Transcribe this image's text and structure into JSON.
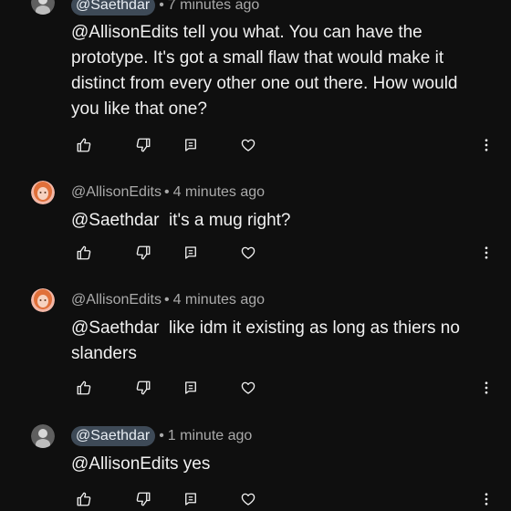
{
  "comments": [
    {
      "author": "@Saethdar",
      "author_chip": true,
      "time": "7 minutes ago",
      "text": "@AllisonEdits tell you what. You can have the prototype. It's got a small flaw that would make it distinct from every other one out there. How would you like that one?",
      "avatar": "user-avatar-gray"
    },
    {
      "author": "@AllisonEdits",
      "author_chip": false,
      "time": "4 minutes ago",
      "text": "@Saethdar  it's a mug right?",
      "avatar": "user-avatar-orange-hair"
    },
    {
      "author": "@AllisonEdits",
      "author_chip": false,
      "time": "4 minutes ago",
      "text": "@Saethdar  like idm it existing as long as thiers no slanders",
      "avatar": "user-avatar-orange-hair"
    },
    {
      "author": "@Saethdar",
      "author_chip": true,
      "time": "1 minute ago",
      "text": "@AllisonEdits yes",
      "avatar": "user-avatar-gray"
    }
  ],
  "separator": "•",
  "icons": {
    "like": "thumbs-up-icon",
    "dislike": "thumbs-down-icon",
    "reply": "reply-comment-icon",
    "heart": "heart-icon",
    "more": "more-vert-icon"
  },
  "colors": {
    "background": "#0f0f0f",
    "text": "#f1f1f1",
    "meta": "#aaaaaa",
    "chip": "#3e4a57"
  }
}
